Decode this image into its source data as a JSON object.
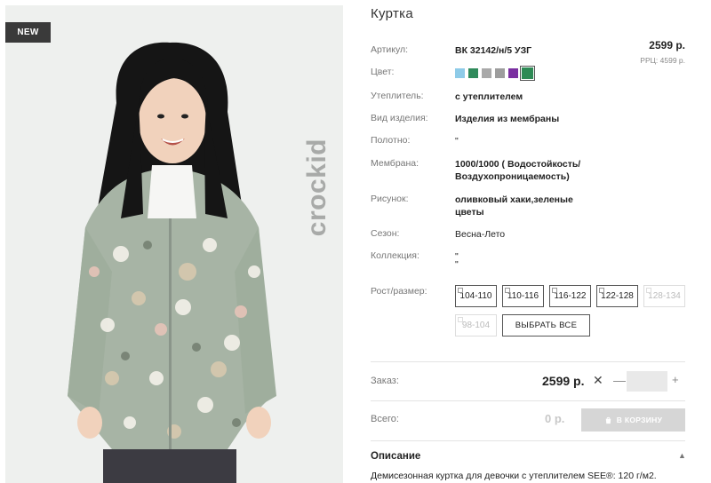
{
  "badge": "NEW",
  "brand_watermark": "crockid",
  "product": {
    "title": "Куртка",
    "price": "2599 р.",
    "rrp": "РРЦ: 4599 р."
  },
  "attributes": [
    {
      "label": "Артикул:",
      "value": "ВК 32142/н/5 УЗГ"
    },
    {
      "label": "Цвет:",
      "value": ""
    },
    {
      "label": "Утеплитель:",
      "value": "с утеплителем"
    },
    {
      "label": "Вид изделия:",
      "value": "Изделия из мембраны"
    },
    {
      "label": "Полотно:",
      "value": "\""
    },
    {
      "label": "Мембрана:",
      "value": "1000/1000 ( Водостойкость/",
      "value2": "Воздухопроницаемость)"
    },
    {
      "label": "Рисунок:",
      "value": "оливковый хаки,зеленые",
      "value2": "цветы"
    },
    {
      "label": "Сезон:",
      "value": "Весна-Лето"
    },
    {
      "label": "Коллекция:",
      "value": "\"",
      "value2": "\""
    }
  ],
  "colors": [
    "#8ecbe8",
    "#2f8a5b",
    "#a9a9a9",
    "#9d9d9d",
    "#7a2fa0",
    "#2e8a55"
  ],
  "sizes_label": "Рост/размер:",
  "sizes": [
    {
      "label": "104-110",
      "available": true
    },
    {
      "label": "110-116",
      "available": true
    },
    {
      "label": "116-122",
      "available": true
    },
    {
      "label": "122-128",
      "available": true
    },
    {
      "label": "128-134",
      "available": false
    },
    {
      "label": "98-104",
      "available": false
    }
  ],
  "select_all_label": "ВЫБРАТЬ ВСЕ",
  "order": {
    "label": "Заказ:",
    "price": "2599 р.",
    "times": "✕",
    "minus": "—",
    "plus": "+",
    "quantity": ""
  },
  "total": {
    "label": "Всего:",
    "value": "0 р.",
    "cart_label": "В КОРЗИНУ"
  },
  "description": {
    "title": "Описание",
    "text": "Демисезонная куртка для девочки с утеплителем SEE®: 120 г/м2."
  }
}
